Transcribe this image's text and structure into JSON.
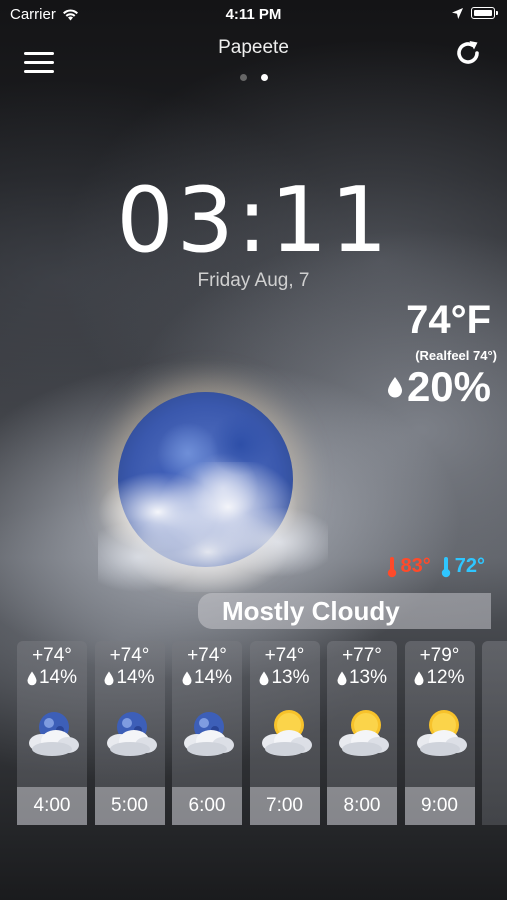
{
  "status_bar": {
    "carrier": "Carrier",
    "time": "4:11 PM",
    "icons": [
      "wifi-icon",
      "location-arrow-icon",
      "battery-icon"
    ]
  },
  "header": {
    "city": "Papeete",
    "page_count": 2,
    "active_page": 2,
    "menu_icon": "hamburger-menu-icon",
    "refresh_icon": "refresh-icon"
  },
  "clock": {
    "time": "03:11",
    "date": "Friday Aug, 7"
  },
  "current": {
    "temperature": "74°F",
    "realfeel": "(Realfeel 74°)",
    "precip_chance": "20%",
    "icon": "moon-cloudy-icon"
  },
  "high_low": {
    "high": "83°",
    "low": "72°",
    "high_color": "#ff4a2a",
    "low_color": "#2fc6ff"
  },
  "condition": "Mostly Cloudy",
  "hourly": [
    {
      "temp": "+74°",
      "pop": "14%",
      "time": "4:00",
      "icon": "moon-cloud-icon"
    },
    {
      "temp": "+74°",
      "pop": "14%",
      "time": "5:00",
      "icon": "moon-cloud-icon"
    },
    {
      "temp": "+74°",
      "pop": "14%",
      "time": "6:00",
      "icon": "moon-cloud-icon"
    },
    {
      "temp": "+74°",
      "pop": "13%",
      "time": "7:00",
      "icon": "sun-cloud-icon"
    },
    {
      "temp": "+77°",
      "pop": "13%",
      "time": "8:00",
      "icon": "sun-cloud-icon"
    },
    {
      "temp": "+79°",
      "pop": "12%",
      "time": "9:00",
      "icon": "sun-cloud-icon"
    }
  ]
}
